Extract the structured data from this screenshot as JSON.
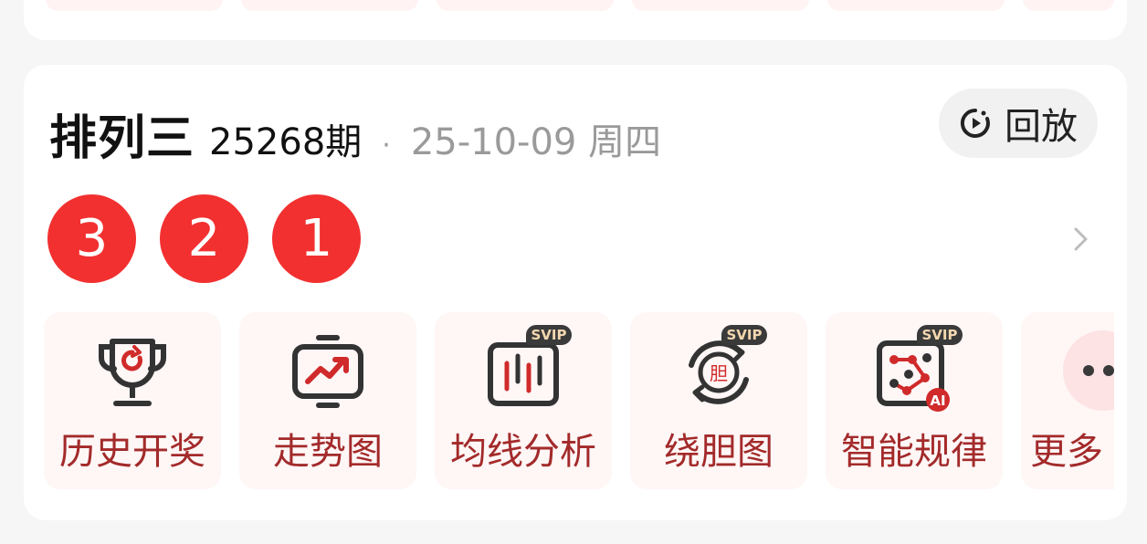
{
  "draw": {
    "lottery_name": "排列三",
    "issue": "25268期",
    "separator": "·",
    "date": "25-10-09 周四",
    "replay_label": "回放",
    "balls": [
      "3",
      "2",
      "1"
    ]
  },
  "tools": [
    {
      "label": "历史开奖",
      "icon": "trophy-icon",
      "badge": ""
    },
    {
      "label": "走势图",
      "icon": "trend-chart-icon",
      "badge": ""
    },
    {
      "label": "均线分析",
      "icon": "candlestick-icon",
      "badge": "SVIP"
    },
    {
      "label": "绕胆图",
      "icon": "orbit-icon",
      "badge": "SVIP"
    },
    {
      "label": "智能规律",
      "icon": "ai-pattern-icon",
      "badge": "SVIP"
    },
    {
      "label": "更多",
      "icon": "more-icon",
      "badge": ""
    }
  ],
  "colors": {
    "ball": "#f23030",
    "tool_label": "#a32a2a",
    "tool_bg": "#fff6f6",
    "svip_bg": "#3a3a3a",
    "svip_text": "#f3d7b0"
  }
}
